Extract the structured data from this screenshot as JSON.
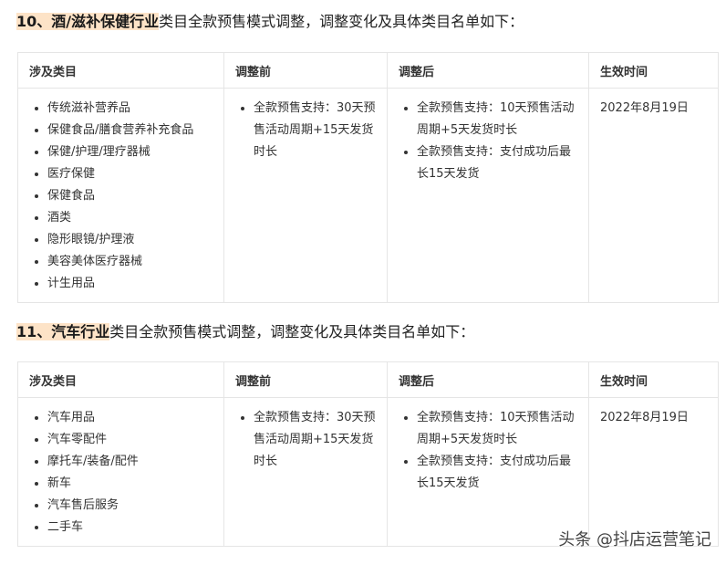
{
  "section1": {
    "heading_highlight": "10、酒/滋补保健行业",
    "heading_rest": "类目全款预售模式调整，调整变化及具体类目名单如下：",
    "columns": [
      "涉及类目",
      "调整前",
      "调整后",
      "生效时间"
    ],
    "categories": [
      "传统滋补营养品",
      "保健食品/膳食营养补充食品",
      "保健/护理/理疗器械",
      "医疗保健",
      "保健食品",
      "酒类",
      "隐形眼镜/护理液",
      "美容美体医疗器械",
      "计生用品"
    ],
    "before": [
      "全款预售支持：30天预售活动周期+15天发货时长"
    ],
    "after": [
      "全款预售支持：10天预售活动周期+5天发货时长",
      "全款预售支持：支付成功后最长15天发货"
    ],
    "effective": "2022年8月19日"
  },
  "section2": {
    "heading_highlight": "11、汽车行业",
    "heading_rest": "类目全款预售模式调整，调整变化及具体类目名单如下：",
    "columns": [
      "涉及类目",
      "调整前",
      "调整后",
      "生效时间"
    ],
    "categories": [
      "汽车用品",
      "汽车零配件",
      "摩托车/装备/配件",
      "新车",
      "汽车售后服务",
      "二手车"
    ],
    "before": [
      "全款预售支持：30天预售活动周期+15天发货时长"
    ],
    "after": [
      "全款预售支持：10天预售活动周期+5天发货时长",
      "全款预售支持：支付成功后最长15天发货"
    ],
    "effective": "2022年8月19日"
  },
  "watermark": "头条 @抖店运营笔记"
}
